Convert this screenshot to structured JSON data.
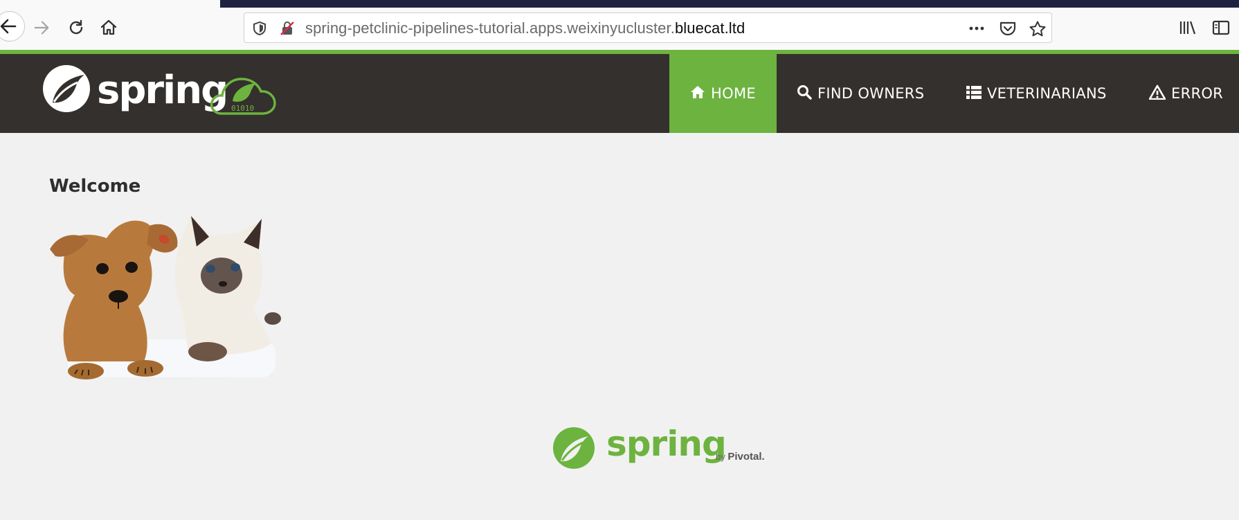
{
  "browser": {
    "url_path": "spring-petclinic-pipelines-tutorial.apps.weixinyucluster.",
    "url_host": "bluecat.ltd",
    "icons": [
      "back-icon",
      "forward-icon",
      "reload-icon",
      "home-icon",
      "tracking-shield-icon",
      "insecure-lock-icon",
      "page-actions-icon",
      "pocket-icon",
      "bookmark-star-icon",
      "library-icon",
      "sidebar-icon"
    ]
  },
  "navbar": {
    "brand": "spring",
    "brand_badge": "01010",
    "items": [
      {
        "label": "HOME",
        "icon": "home-icon",
        "active": true
      },
      {
        "label": "FIND OWNERS",
        "icon": "search-icon",
        "active": false
      },
      {
        "label": "VETERINARIANS",
        "icon": "list-icon",
        "active": false
      },
      {
        "label": "ERROR",
        "icon": "warning-icon",
        "active": false
      }
    ]
  },
  "main": {
    "heading": "Welcome",
    "image_alt": "puppy and kitten"
  },
  "footer": {
    "brand": "spring",
    "by": "by",
    "company": "Pivotal."
  },
  "colors": {
    "accent": "#6db33f",
    "navbar_bg": "#34302d",
    "page_bg": "#f1f1f1"
  }
}
